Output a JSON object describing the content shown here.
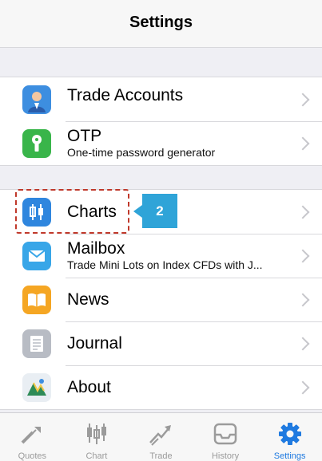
{
  "header": {
    "title": "Settings"
  },
  "groups": [
    {
      "items": [
        {
          "label": "Trade Accounts",
          "icon": "user-icon",
          "color": "#3d8ee0"
        },
        {
          "label": "OTP",
          "sublabel": "One-time password generator",
          "icon": "key-icon",
          "color": "#39b54a"
        }
      ]
    },
    {
      "items": [
        {
          "label": "Charts",
          "icon": "candlestick-chart-icon",
          "color": "#2f86de"
        },
        {
          "label": "Mailbox",
          "sublabel": "Trade Mini Lots on Index CFDs with J...",
          "icon": "envelope-icon",
          "color": "#38a6e8"
        },
        {
          "label": "News",
          "icon": "book-icon",
          "color": "#f5a623"
        },
        {
          "label": "Journal",
          "icon": "document-icon",
          "color": "#b8bcc4"
        },
        {
          "label": "About",
          "icon": "metatrader-logo-icon"
        }
      ]
    }
  ],
  "annotation": {
    "callout_number": "2",
    "highlight_color": "#c0392b",
    "callout_color": "#2fa4d8"
  },
  "tabbar": {
    "active": "Settings",
    "tabs": [
      {
        "label": "Quotes",
        "icon": "quotes-arrows-icon"
      },
      {
        "label": "Chart",
        "icon": "candlestick-icon"
      },
      {
        "label": "Trade",
        "icon": "trade-line-icon"
      },
      {
        "label": "History",
        "icon": "inbox-tray-icon"
      },
      {
        "label": "Settings",
        "icon": "gear-icon"
      }
    ]
  }
}
